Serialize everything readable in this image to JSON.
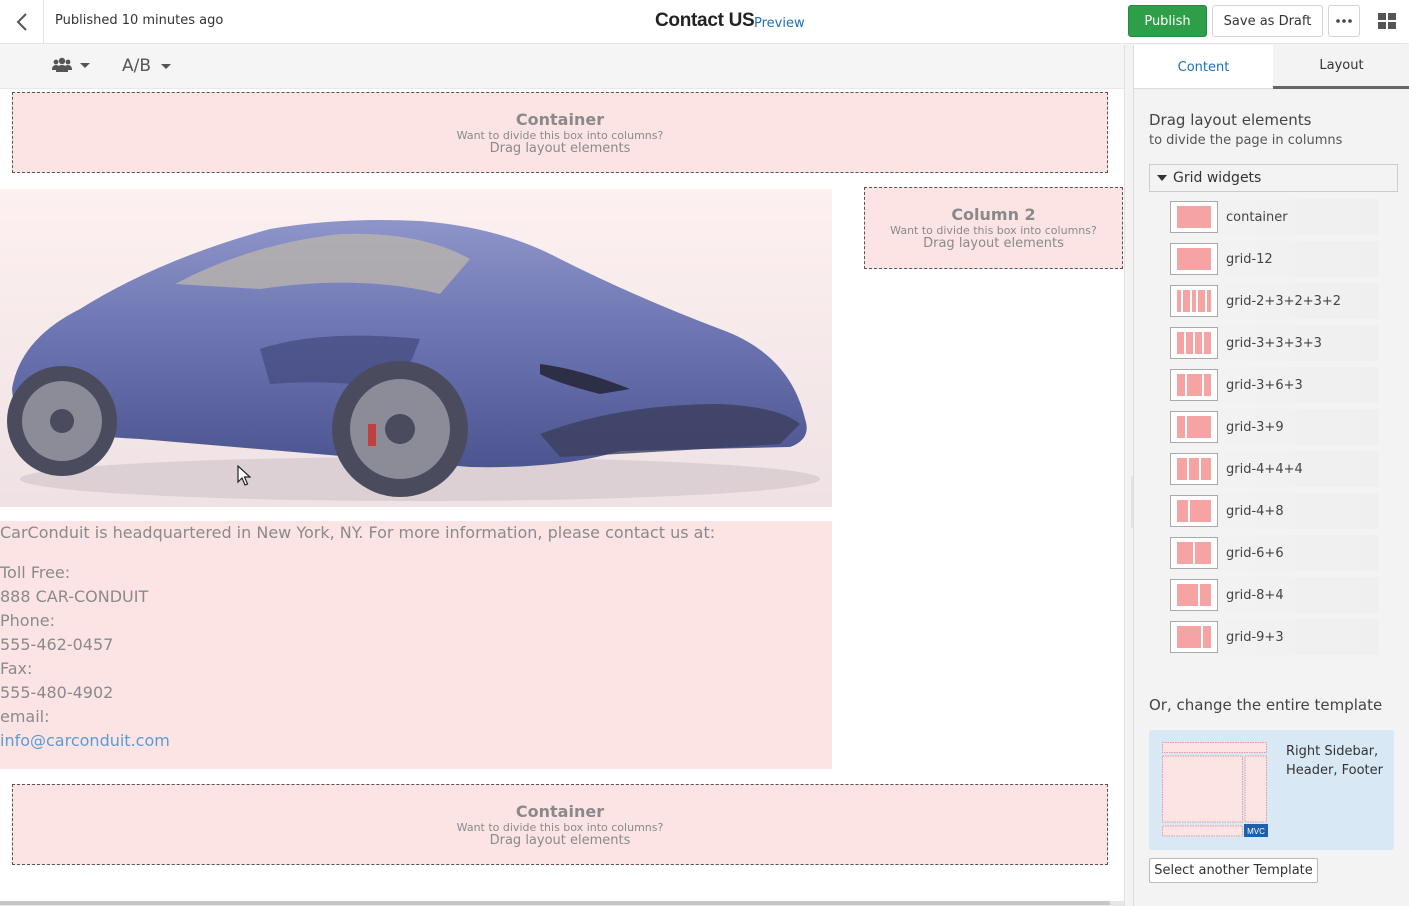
{
  "header": {
    "status": "Published 10 minutes ago",
    "title": "Contact US",
    "preview_label": "Preview",
    "publish_label": "Publish",
    "save_draft_label": "Save as Draft",
    "more_icon": "ellipsis-icon",
    "apps_icon": "grid-apps-icon"
  },
  "toolbar": {
    "persona_icon": "users-icon",
    "ab_label": "A/B"
  },
  "canvas": {
    "drop_zone_title_container": "Container",
    "drop_zone_title_column": "Column 2",
    "drop_zone_hint": "Want to divide this box into columns?",
    "drop_zone_action": "Drag layout elements",
    "image_alt": "blue sports car",
    "intro": "CarConduit is headquartered in New York, NY. For more information, please contact us at:",
    "contact_lines": [
      "Toll Free:",
      "888 CAR-CONDUIT",
      "Phone:",
      "555-462-0457",
      "Fax:",
      "555-480-4902",
      "email:"
    ],
    "email_link": "info@carconduit.com"
  },
  "panel": {
    "tabs": [
      {
        "label": "Content"
      },
      {
        "label": "Layout"
      }
    ],
    "title": "Drag layout elements",
    "subtitle": "to divide the page in columns",
    "group_label": "Grid widgets",
    "widgets": [
      {
        "label": "container",
        "cols": [
          12
        ]
      },
      {
        "label": "grid-12",
        "cols": [
          12
        ]
      },
      {
        "label": "grid-2+3+2+3+2",
        "cols": [
          2,
          3,
          2,
          3,
          2
        ]
      },
      {
        "label": "grid-3+3+3+3",
        "cols": [
          3,
          3,
          3,
          3
        ]
      },
      {
        "label": "grid-3+6+3",
        "cols": [
          3,
          6,
          3
        ]
      },
      {
        "label": "grid-3+9",
        "cols": [
          3,
          9
        ]
      },
      {
        "label": "grid-4+4+4",
        "cols": [
          4,
          4,
          4
        ]
      },
      {
        "label": "grid-4+8",
        "cols": [
          4,
          8
        ]
      },
      {
        "label": "grid-6+6",
        "cols": [
          6,
          6
        ]
      },
      {
        "label": "grid-8+4",
        "cols": [
          8,
          4
        ]
      },
      {
        "label": "grid-9+3",
        "cols": [
          9,
          3
        ]
      }
    ],
    "change_template_label": "Or, change the entire template",
    "template_name_line1": "Right Sidebar,",
    "template_name_line2": "Header, Footer",
    "template_badge": "MVC",
    "select_template_label": "Select another Template"
  },
  "colors": {
    "publish_green": "#2e9e48",
    "link_blue": "#1e6fb5",
    "drop_zone_pink": "#fde4e4",
    "widget_pink": "#f5a3a3",
    "template_card_blue": "#d8e8f5"
  }
}
